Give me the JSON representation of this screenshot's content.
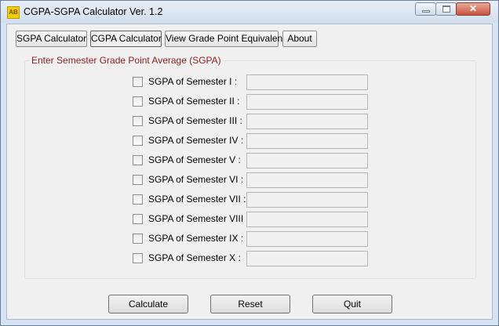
{
  "window": {
    "title": "CGPA-SGPA Calculator Ver. 1.2",
    "icon_text": "AB",
    "close_glyph": "✕"
  },
  "tabs": [
    {
      "label": "SGPA Calculator"
    },
    {
      "label": "CGPA Calculator"
    },
    {
      "label": "View Grade Point Equivalent"
    },
    {
      "label": "About"
    }
  ],
  "group": {
    "label": "Enter Semester Grade Point Average (SGPA)",
    "label_color": "#8b1c1c"
  },
  "semesters": [
    {
      "label": "SGPA of Semester I :",
      "checked": false,
      "value": ""
    },
    {
      "label": "SGPA of Semester II :",
      "checked": false,
      "value": ""
    },
    {
      "label": "SGPA of Semester III :",
      "checked": false,
      "value": ""
    },
    {
      "label": "SGPA of Semester IV :",
      "checked": false,
      "value": ""
    },
    {
      "label": "SGPA of Semester V :",
      "checked": false,
      "value": ""
    },
    {
      "label": "SGPA of Semester VI :",
      "checked": false,
      "value": ""
    },
    {
      "label": "SGPA of Semester VII :",
      "checked": false,
      "value": ""
    },
    {
      "label": "SGPA of Semester VIII :",
      "checked": false,
      "value": ""
    },
    {
      "label": "SGPA of Semester IX :",
      "checked": false,
      "value": ""
    },
    {
      "label": "SGPA of Semester X :",
      "checked": false,
      "value": ""
    }
  ],
  "buttons": {
    "calculate": "Calculate",
    "reset": "Reset",
    "quit": "Quit"
  }
}
